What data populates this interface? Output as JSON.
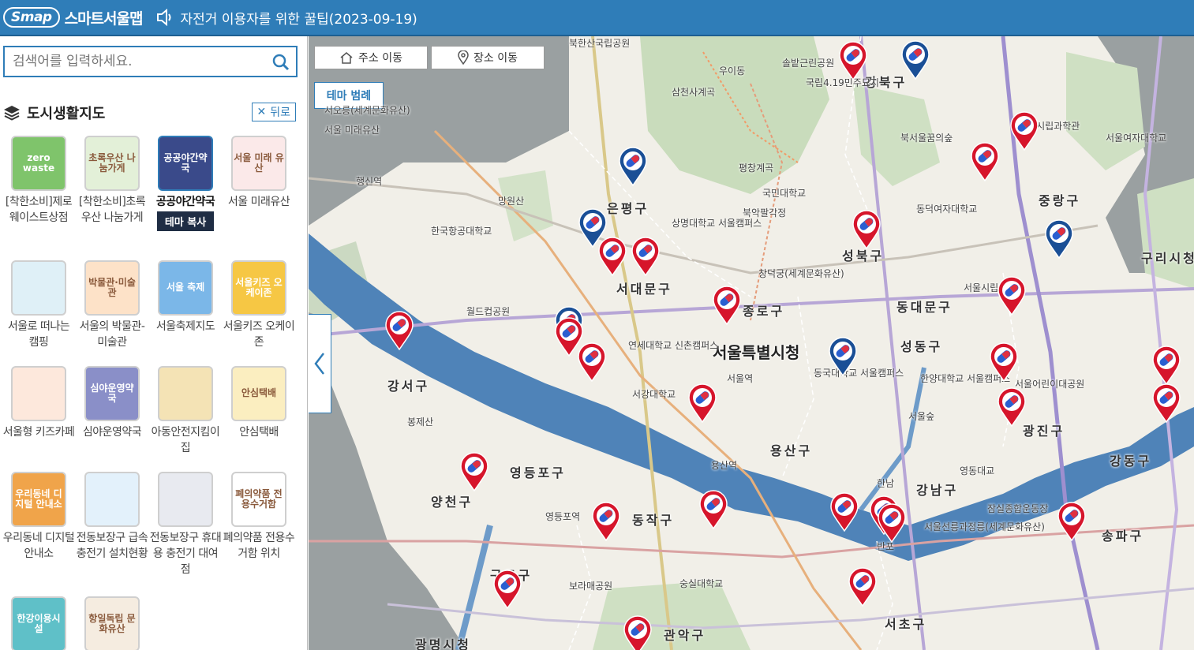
{
  "header": {
    "logo_mark": "Smap",
    "app_title": "스마트서울맵",
    "notice_text": "자전거 이용자를 위한 꿀팁(2023-09-19)"
  },
  "search": {
    "placeholder": "검색어를 입력하세요."
  },
  "section": {
    "title": "도시생활지도",
    "back_label": "뒤로"
  },
  "themes": [
    {
      "label": "[착한소비]제로웨이스트상점",
      "tile_text": "zero waste",
      "color": "#7fc46b",
      "icon": "zero-waste-icon"
    },
    {
      "label": "[착한소비]초록우산 나눔가게",
      "tile_text": "초록우산 나눔가게",
      "color": "#e3f0d8",
      "icon": "green-umbrella-icon"
    },
    {
      "label": "공공야간약국",
      "tile_text": "공공야간약국",
      "color": "#3a4a8a",
      "icon": "night-pharmacy-icon",
      "selected": true
    },
    {
      "label": "서울 미래유산",
      "tile_text": "서울 미래 유산",
      "color": "#fbe9e9",
      "icon": "future-heritage-icon"
    },
    {
      "label": "서울로 떠나는 캠핑",
      "tile_text": "",
      "color": "#dff0f7",
      "icon": "camping-icon"
    },
    {
      "label": "서울의 박물관-미술관",
      "tile_text": "박물관·미술관",
      "color": "#fde2c8",
      "icon": "museum-icon"
    },
    {
      "label": "서울축제지도",
      "tile_text": "서울 축제",
      "color": "#7bb7e8",
      "icon": "festival-icon"
    },
    {
      "label": "서울키즈 오케이존",
      "tile_text": "서울키즈 오케이존",
      "color": "#f6c744",
      "icon": "kids-ok-zone-icon"
    },
    {
      "label": "서울형 키즈카페",
      "tile_text": "",
      "color": "#fde8dc",
      "icon": "kids-cafe-icon"
    },
    {
      "label": "심야운영약국",
      "tile_text": "심야운영약국",
      "color": "#8a8fc8",
      "icon": "late-pharmacy-icon"
    },
    {
      "label": "아동안전지킴이집",
      "tile_text": "",
      "color": "#f4e3b5",
      "icon": "child-safety-icon"
    },
    {
      "label": "안심택배",
      "tile_text": "안심택배",
      "color": "#fbeec0",
      "icon": "safe-delivery-icon"
    },
    {
      "label": "우리동네 디지털안내소",
      "tile_text": "우리동네 디지털 안내소",
      "color": "#f0a44a",
      "icon": "digital-guide-icon"
    },
    {
      "label": "전동보장구 급속충전기 설치현황",
      "tile_text": "",
      "color": "#e3f1fb",
      "icon": "wheelchair-charger-icon"
    },
    {
      "label": "전동보장구 휴대용 충전기 대여점",
      "tile_text": "",
      "color": "#e8eaf0",
      "icon": "wheelchair-rental-icon"
    },
    {
      "label": "폐의약품 전용수거함 위치",
      "tile_text": "폐의약품 전용수거함",
      "color": "#ffffff",
      "icon": "medicine-bin-icon"
    },
    {
      "label": "",
      "tile_text": "한강이용시설",
      "color": "#5fc0c8",
      "icon": "hangang-facility-icon"
    },
    {
      "label": "",
      "tile_text": "항일독립 문화유산",
      "color": "#f5ece0",
      "icon": "independence-heritage-icon"
    }
  ],
  "copy_theme_label": "테마 복사",
  "map": {
    "address_move": "주소 이동",
    "place_move": "장소 이동",
    "legend_btn": "테마 범례",
    "districts": [
      {
        "name": "강북구"
      },
      {
        "name": "은평구"
      },
      {
        "name": "성북구"
      },
      {
        "name": "중랑구"
      },
      {
        "name": "서대문구"
      },
      {
        "name": "종로구"
      },
      {
        "name": "동대문구"
      },
      {
        "name": "강서구"
      },
      {
        "name": "성동구"
      },
      {
        "name": "광진구"
      },
      {
        "name": "용산구"
      },
      {
        "name": "영등포구"
      },
      {
        "name": "양천구"
      },
      {
        "name": "동작구"
      },
      {
        "name": "강남구"
      },
      {
        "name": "강동구"
      },
      {
        "name": "송파구"
      },
      {
        "name": "관악구"
      },
      {
        "name": "서초구"
      },
      {
        "name": "구로구"
      },
      {
        "name": "구리시청"
      },
      {
        "name": "광명시청"
      }
    ],
    "city_hall": "서울특별시청",
    "places": [
      "북한산국립공원",
      "우이동",
      "솔밭근린공원",
      "국립4.19민주묘지",
      "북서울꿈의숲",
      "서울시립과학관",
      "평창계곡",
      "국민대학교",
      "북악팔각정",
      "상명대학교 서울캠퍼스",
      "창덕궁(세계문화유산)",
      "한국항공대학교",
      "월드컵공원",
      "연세대학교 신촌캠퍼스",
      "서강대학교",
      "동국대학교 서울캠퍼스",
      "서울숲",
      "한양대학교 서울캠퍼스",
      "서울어린이대공원",
      "봉제산",
      "숭실대학교",
      "보라매공원",
      "잠실종합운동장",
      "서울선릉과정릉(세계문화유산)",
      "서울여자대학교",
      "동덕여자대학교",
      "서울시립대학교",
      "망원산",
      "서오릉(세계문화유산)",
      "삼천사계곡",
      "서울 미래유산",
      "행신역",
      "서울역",
      "용산역",
      "영등포역",
      "한남",
      "반포",
      "영동대교"
    ]
  },
  "colors": {
    "brand": "#2f7db8",
    "pin_red": "#d6152b",
    "pin_blue": "#1a4f96"
  }
}
